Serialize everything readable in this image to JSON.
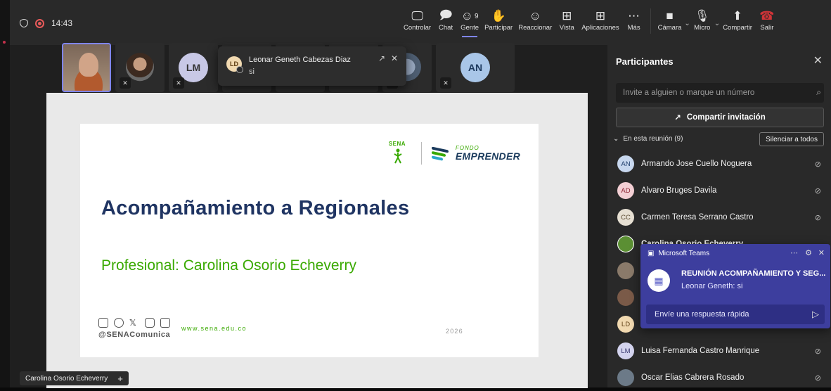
{
  "topbar": {
    "time": "14:43",
    "buttons": [
      {
        "label": "Controlar",
        "icon": "screen-control-icon"
      },
      {
        "label": "Chat",
        "icon": "chat-icon"
      },
      {
        "label": "Gente",
        "icon": "people-icon",
        "badge": "9"
      },
      {
        "label": "Participar",
        "icon": "raise-hand-icon"
      },
      {
        "label": "Reaccionar",
        "icon": "emoji-icon"
      },
      {
        "label": "Vista",
        "icon": "grid-view-icon"
      },
      {
        "label": "Aplicaciones",
        "icon": "apps-icon"
      },
      {
        "label": "Más",
        "icon": "more-icon"
      },
      {
        "label": "Cámara",
        "icon": "camera-off-icon"
      },
      {
        "label": "Micro",
        "icon": "mic-off-icon"
      },
      {
        "label": "Compartir",
        "icon": "share-icon"
      },
      {
        "label": "Salir",
        "icon": "leave-icon"
      }
    ]
  },
  "thumbs": {
    "lm_initials": "LM",
    "an_initials": "AN"
  },
  "toast": {
    "initials": "LD",
    "name": "Leonar Geneth Cabezas Diaz",
    "message": "si"
  },
  "slide": {
    "title": "Acompañamiento a Regionales",
    "subtitle": "Profesional: Carolina Osorio Echeverry",
    "sena_text": "SENA",
    "fondo_top": "FONDO",
    "fondo_main": "EMPRENDER",
    "handle": "@SENAComunica",
    "website": "www.sena.edu.co",
    "year": "2026"
  },
  "stage_name": "Carolina Osorio Echeverry",
  "panel": {
    "title": "Participantes",
    "invite_placeholder": "Invite a alguien o marque un número",
    "share_invite": "Compartir invitación",
    "section": "En esta reunión (9)",
    "mute_all": "Silenciar a todos",
    "participants": [
      {
        "initials": "AN",
        "name": "Armando Jose Cuello Noguera",
        "bg": "#c7d7ee",
        "fg": "#1e3d6b"
      },
      {
        "initials": "AD",
        "name": "Alvaro Bruges Davila",
        "bg": "#f3cfd4",
        "fg": "#8a2433"
      },
      {
        "initials": "CC",
        "name": "Carmen Teresa Serrano Castro",
        "bg": "#e6dfd2",
        "fg": "#5a4a30"
      },
      {
        "initials": "",
        "name": "Carolina Osorio Echeverry",
        "bg": "#5b8f33",
        "fg": "#fff"
      },
      {
        "initials": "",
        "name": "",
        "bg": "#8a7a6a",
        "fg": "#fff"
      },
      {
        "initials": "",
        "name": "",
        "bg": "#7a5a48",
        "fg": "#fff"
      },
      {
        "initials": "LD",
        "name": "",
        "bg": "#f1d9b0",
        "fg": "#5c3b11"
      },
      {
        "initials": "LM",
        "name": "Luisa Fernanda Castro Manrique",
        "bg": "#d3d3ee",
        "fg": "#3a3a70"
      },
      {
        "initials": "",
        "name": "Oscar Elias Cabrera Rosado",
        "bg": "#6c7a88",
        "fg": "#fff"
      }
    ]
  },
  "notification": {
    "app": "Microsoft Teams",
    "title": "REUNIÓN ACOMPAÑAMIENTO Y SEG...",
    "message": "Leonar Geneth: si",
    "reply_placeholder": "Envíe una respuesta rápida"
  },
  "colors": {
    "accent": "#7f85f5",
    "sena_green": "#39a900",
    "slide_navy": "#1f3462",
    "notif_bg": "#3d3e9e"
  }
}
